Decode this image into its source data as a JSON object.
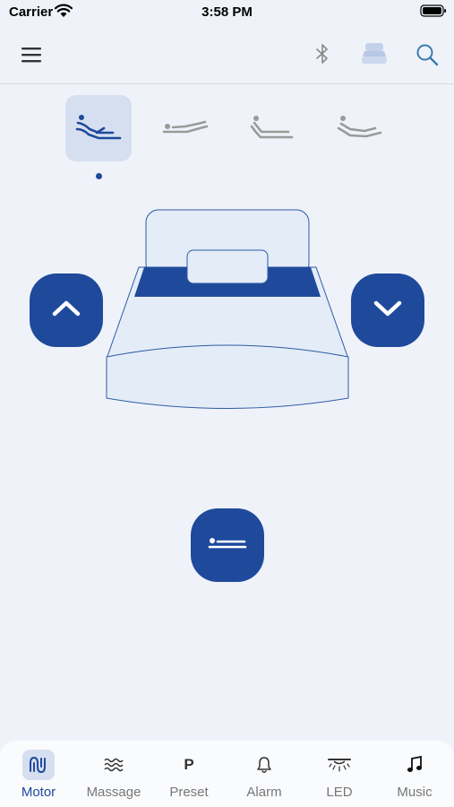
{
  "status_bar": {
    "carrier": "Carrier",
    "time": "3:58 PM"
  },
  "nav": {
    "icons": [
      "menu-icon",
      "bluetooth-icon",
      "bed-device-icon",
      "search-icon"
    ]
  },
  "positions": {
    "selected_index": 0,
    "items": [
      "zero-gravity-icon",
      "flat-lying-icon",
      "head-raised-icon",
      "anti-snore-icon"
    ]
  },
  "controls": {
    "up_icon": "chevron-up-icon",
    "down_icon": "chevron-down-icon",
    "flat_icon": "flat-bed-icon"
  },
  "tabs": [
    {
      "label": "Motor",
      "icon": "motor-icon",
      "active": true
    },
    {
      "label": "Massage",
      "icon": "massage-wave-icon",
      "active": false
    },
    {
      "label": "Preset",
      "icon": "preset-p-icon",
      "glyph": "P",
      "active": false
    },
    {
      "label": "Alarm",
      "icon": "bell-icon",
      "active": false
    },
    {
      "label": "LED",
      "icon": "lamp-icon",
      "active": false
    },
    {
      "label": "Music",
      "icon": "music-note-icon",
      "active": false
    }
  ],
  "colors": {
    "accent": "#1f4a9c",
    "background": "#eff3f9",
    "bed_fill": "#e4ecf8",
    "inactive_icon": "#9a9a9a"
  }
}
